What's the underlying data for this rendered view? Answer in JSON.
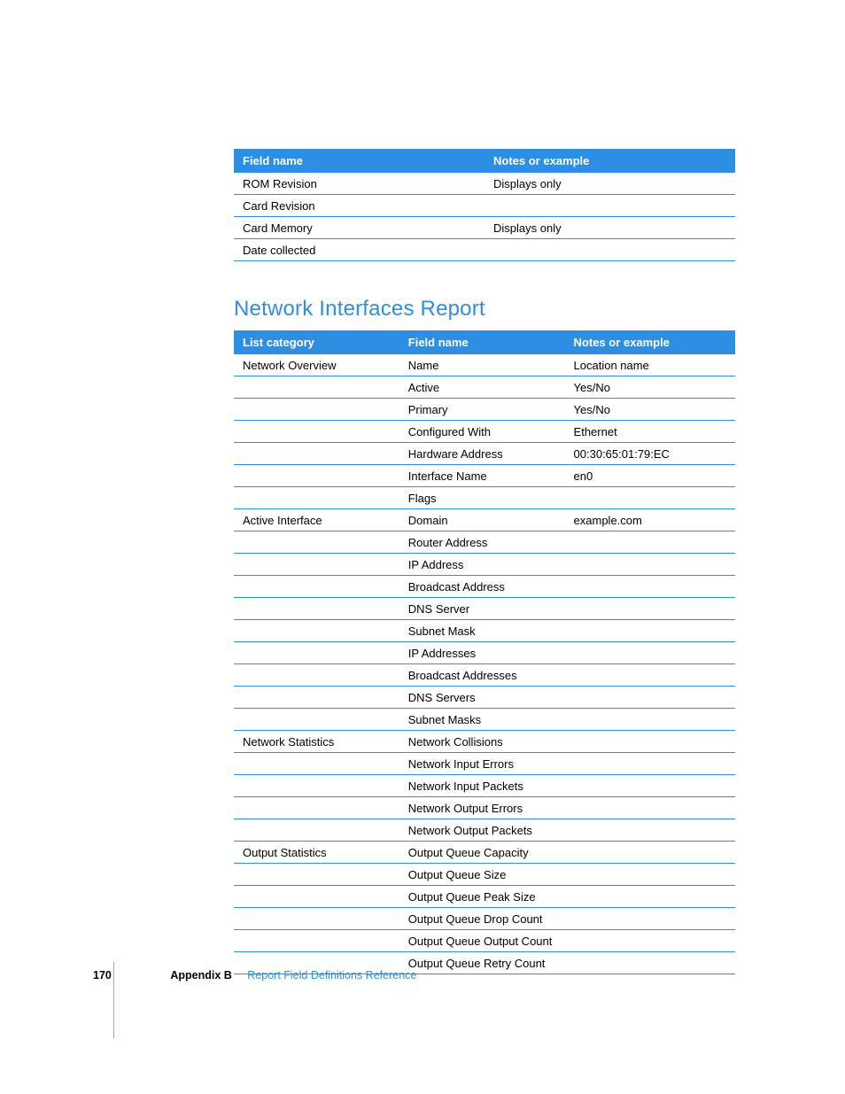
{
  "table1": {
    "headers": [
      "Field name",
      "Notes or example"
    ],
    "rows": [
      [
        "ROM Revision",
        "Displays only"
      ],
      [
        "Card Revision",
        ""
      ],
      [
        "Card Memory",
        "Displays only"
      ],
      [
        "Date collected",
        ""
      ]
    ]
  },
  "section_title": "Network Interfaces Report",
  "table2": {
    "headers": [
      "List category",
      "Field name",
      "Notes or example"
    ],
    "rows": [
      [
        "Network Overview",
        "Name",
        "Location name"
      ],
      [
        "",
        "Active",
        "Yes/No"
      ],
      [
        "",
        "Primary",
        "Yes/No"
      ],
      [
        "",
        "Configured With",
        "Ethernet"
      ],
      [
        "",
        "Hardware Address",
        "00:30:65:01:79:EC"
      ],
      [
        "",
        "Interface Name",
        "en0"
      ],
      [
        "",
        "Flags",
        ""
      ],
      [
        "Active Interface",
        "Domain",
        "example.com"
      ],
      [
        "",
        "Router Address",
        ""
      ],
      [
        "",
        "IP Address",
        ""
      ],
      [
        "",
        "Broadcast Address",
        ""
      ],
      [
        "",
        "DNS Server",
        ""
      ],
      [
        "",
        "Subnet Mask",
        ""
      ],
      [
        "",
        "IP Addresses",
        ""
      ],
      [
        "",
        "Broadcast Addresses",
        ""
      ],
      [
        "",
        "DNS Servers",
        ""
      ],
      [
        "",
        "Subnet Masks",
        ""
      ],
      [
        "Network Statistics",
        "Network Collisions",
        ""
      ],
      [
        "",
        "Network Input Errors",
        ""
      ],
      [
        "",
        "Network Input Packets",
        ""
      ],
      [
        "",
        "Network Output Errors",
        ""
      ],
      [
        "",
        "Network Output Packets",
        ""
      ],
      [
        "Output Statistics",
        "Output Queue Capacity",
        ""
      ],
      [
        "",
        "Output Queue Size",
        ""
      ],
      [
        "",
        "Output Queue Peak Size",
        ""
      ],
      [
        "",
        "Output Queue Drop Count",
        ""
      ],
      [
        "",
        "Output Queue Output Count",
        ""
      ],
      [
        "",
        "Output Queue Retry Count",
        ""
      ]
    ]
  },
  "footer": {
    "page_number": "170",
    "appendix": "Appendix B",
    "link_text": "Report Field Definitions Reference"
  }
}
